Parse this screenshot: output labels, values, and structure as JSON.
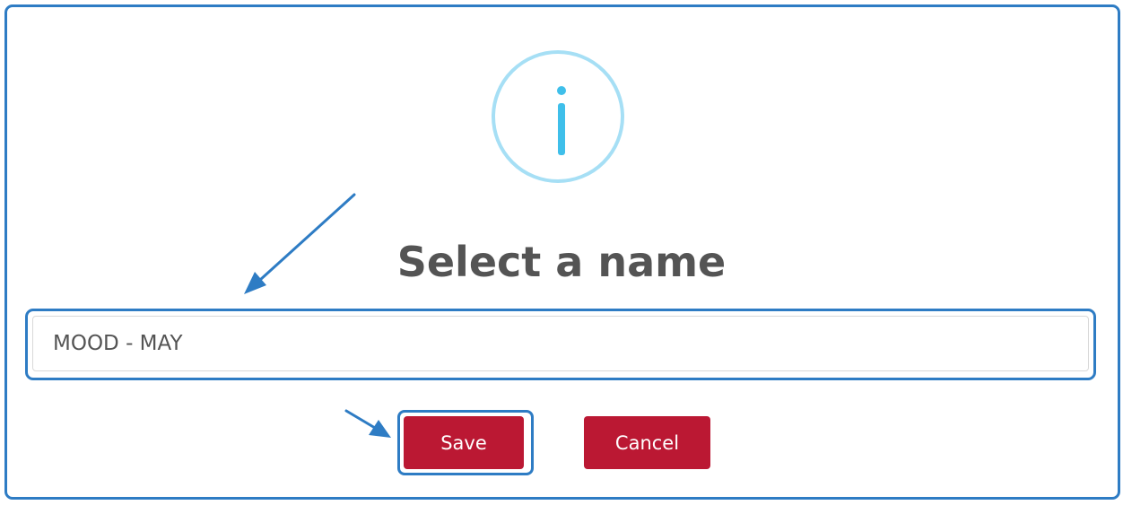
{
  "dialog": {
    "icon": "info-icon",
    "title": "Select a name",
    "name_input": {
      "value": "MOOD - MAY",
      "placeholder": ""
    },
    "save_label": "Save",
    "cancel_label": "Cancel"
  },
  "colors": {
    "highlight": "#2e7cc4",
    "icon_ring": "#a6dff5",
    "icon_glyph": "#3fbfea",
    "button": "#bb1833",
    "title_text": "#545454"
  },
  "annotations": {
    "arrow_icon": "arrow-icon",
    "arrow_targets": [
      "name-input",
      "save-button"
    ]
  }
}
